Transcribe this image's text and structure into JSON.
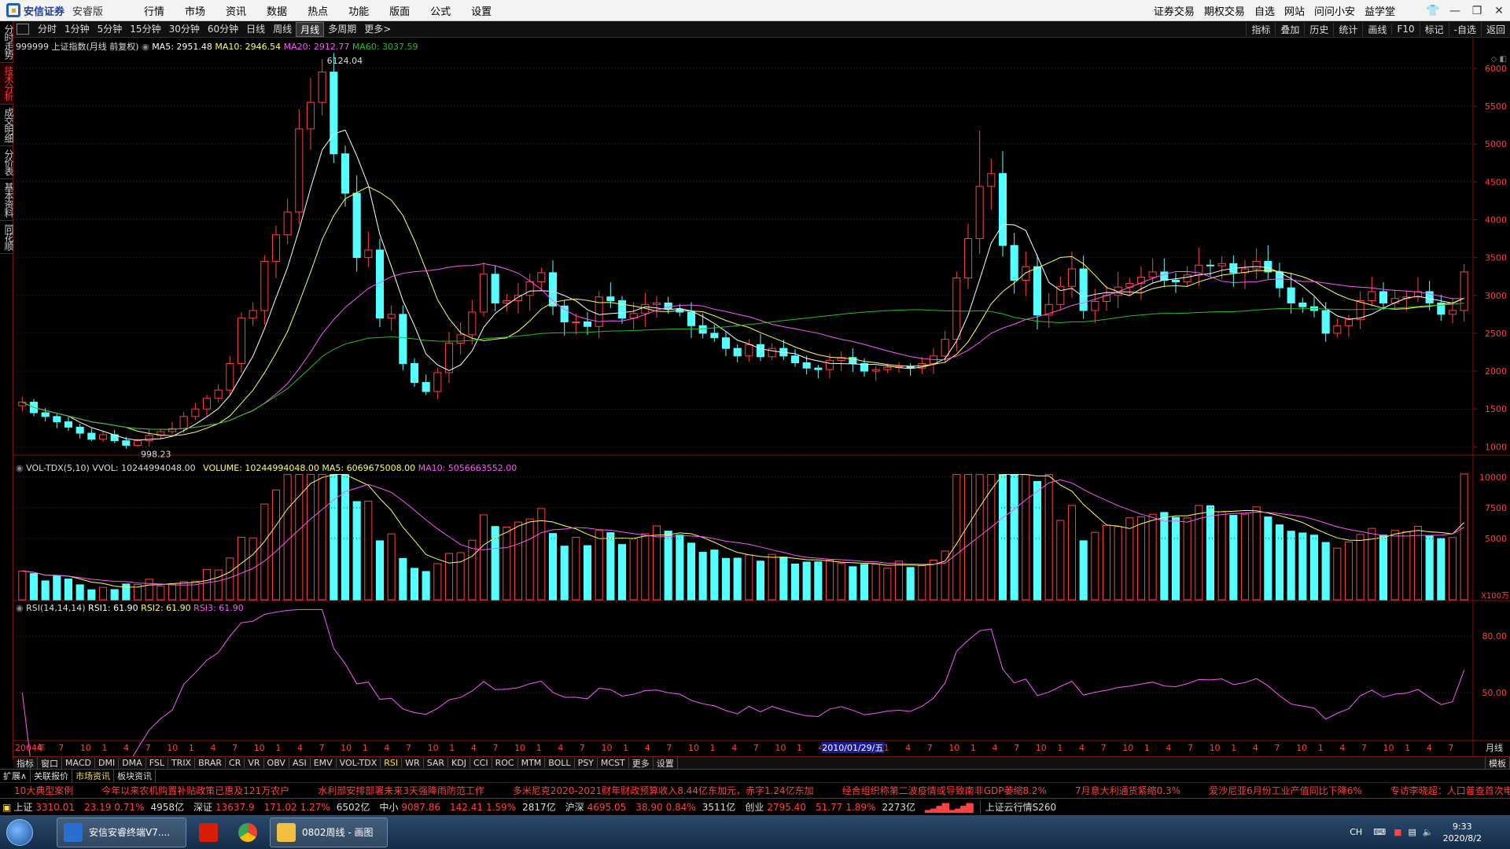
{
  "app": {
    "logo": "安信证券",
    "edition": "安睿版",
    "menu": [
      "行情",
      "市场",
      "资讯",
      "数据",
      "热点",
      "功能",
      "版面",
      "公式",
      "设置"
    ],
    "menu_right": [
      "证券交易",
      "期权交易",
      "自选",
      "网站",
      "问问小安",
      "益学堂"
    ],
    "window_controls": [
      "shirt-icon",
      "minimize-icon",
      "restore-icon",
      "close-icon"
    ]
  },
  "left_tabs": [
    "分时走势",
    "技术分析",
    "成交明细",
    "分价表",
    "基本资料",
    "同花顺"
  ],
  "left_tab_active": 1,
  "period_bar": {
    "items": [
      "分时",
      "1分钟",
      "5分钟",
      "15分钟",
      "30分钟",
      "60分钟",
      "日线",
      "周线",
      "月线",
      "多周期",
      "更多>"
    ],
    "active": "月线",
    "right_items": [
      "指标",
      "叠加",
      "历史",
      "统计",
      "画线",
      "F10",
      "标记",
      "-自选",
      "返回"
    ]
  },
  "main_chart": {
    "code_name": "999999 上证指数(月线 前复权)",
    "ma5": "MA5: 2951.48",
    "ma10": "MA10: 2946.54",
    "ma20": "MA20: 2912.77",
    "ma60": "MA60: 3037.59",
    "high_label": "6124.04",
    "low_label": "998.23",
    "y_ticks": [
      "6000",
      "5500",
      "5000",
      "4500",
      "4000",
      "3500",
      "3000",
      "2500",
      "2000",
      "1500",
      "1000"
    ],
    "corner_right": "月线"
  },
  "vol_chart": {
    "title": "VOL-TDX(5,10)",
    "vvol": "VVOL: 10244994048.00",
    "volume": "VOLUME: 10244994048.00",
    "ma5": "MA5: 6069675008.00",
    "ma10": "MA10: 5056663552.00",
    "y_ticks": [
      "10000",
      "7500",
      "5000"
    ],
    "unit": "X100万"
  },
  "rsi_chart": {
    "title": "RSI(14,14,14)",
    "rsi1": "RSI1: 61.90",
    "rsi2": "RSI2: 61.90",
    "rsi3": "RSI3: 61.90",
    "y_ticks": [
      "80.00",
      "50.00"
    ]
  },
  "x_axis": {
    "labels": [
      "2004年",
      "4",
      "7",
      "10",
      "1",
      "4",
      "7",
      "10",
      "1",
      "4",
      "7",
      "10",
      "1",
      "4",
      "7",
      "10",
      "1",
      "4",
      "7",
      "10",
      "1",
      "4",
      "7",
      "10",
      "1",
      "4",
      "7",
      "10",
      "1",
      "4",
      "7",
      "10",
      "1",
      "4",
      "7",
      "10",
      "1",
      "4",
      "7",
      "10",
      "1",
      "4",
      "7",
      "10",
      "1",
      "4",
      "7",
      "10",
      "1",
      "4",
      "7",
      "10",
      "1",
      "4",
      "7",
      "10",
      "1",
      "4",
      "7",
      "10",
      "1",
      "4",
      "7",
      "10",
      "1",
      "4",
      "7"
    ],
    "cursor_label": "2010/01/29/五"
  },
  "bottom_tabs": [
    "指标",
    "窗口",
    "MACD",
    "DMI",
    "DMA",
    "FSL",
    "TRIX",
    "BRAR",
    "CR",
    "VR",
    "OBV",
    "ASI",
    "EMV",
    "VOL-TDX",
    "RSI",
    "WR",
    "SAR",
    "KDJ",
    "CCI",
    "ROC",
    "MTM",
    "BOLL",
    "PSY",
    "MCST",
    "更多",
    "设置"
  ],
  "bottom_tabs_right": "模板",
  "news_tabs": [
    "扩展∧",
    "关联报价",
    "市场资讯",
    "板块资讯"
  ],
  "news_tab_active": "市场资讯",
  "ticker": [
    "10大典型案例",
    "今年以来农机购置补贴政策已惠及121万农户",
    "水利部安排部署未来3天强降雨防范工作",
    "多米尼克2020-2021财年财政预算收入8.44亿东加元，赤字1.24亿东加",
    "经合组织称第二波疫情或导致南非GDP萎缩8.2%",
    "7月意大利通货紧缩0.3%",
    "爱沙尼亚6月份工业产值同比下降6%",
    "专访李晓超：人口普查首次电子化登"
  ],
  "indexes": [
    {
      "name": "上证",
      "value": "3310.01",
      "chg": "23.19",
      "pct": "0.71%",
      "amt": "4958亿"
    },
    {
      "name": "深证",
      "value": "13637.9",
      "chg": "171.02",
      "pct": "1.27%",
      "amt": "6502亿"
    },
    {
      "name": "中小",
      "value": "9087.86",
      "chg": "142.41",
      "pct": "1.59%",
      "amt": "2817亿"
    },
    {
      "name": "沪深",
      "value": "4695.05",
      "chg": "38.90",
      "pct": "0.84%",
      "amt": "3511亿"
    },
    {
      "name": "创业",
      "value": "2795.40",
      "chg": "51.77",
      "pct": "1.89%",
      "amt": "2273亿"
    }
  ],
  "cloud_status": "上证云行情S260",
  "taskbar": {
    "tasks": [
      "安信安睿终端V7....",
      "0802周线 - 画图"
    ],
    "lang": "CH",
    "time": "9:33",
    "date": "2020/8/2"
  },
  "colors": {
    "up": "#ff4040",
    "down": "#54ffff",
    "ma5": "#ffffff",
    "ma10": "#ffff55",
    "ma20": "#ff55ff",
    "ma60": "#22c022",
    "grid": "#8a1010"
  },
  "chart_data": {
    "type": "candlestick",
    "title": "999999 上证指数(月线 前复权)",
    "ylim": [
      900,
      6300
    ],
    "approx_closes": [
      1590,
      1450,
      1400,
      1330,
      1260,
      1180,
      1100,
      1160,
      1080,
      1020,
      1080,
      1150,
      1200,
      1240,
      1400,
      1500,
      1640,
      1750,
      2100,
      2700,
      2800,
      3450,
      3800,
      4100,
      5200,
      5550,
      5950,
      4870,
      4350,
      3500,
      3600,
      2700,
      2750,
      2100,
      1850,
      1730,
      1980,
      2370,
      2480,
      2780,
      3280,
      2900,
      2930,
      3000,
      3180,
      3300,
      2860,
      2650,
      2650,
      2590,
      2980,
      2930,
      2700,
      2760,
      2880,
      2900,
      2820,
      2780,
      2600,
      2500,
      2440,
      2300,
      2200,
      2350,
      2190,
      2300,
      2200,
      2110,
      2040,
      2020,
      2140,
      2180,
      2100,
      2000,
      2020,
      2050,
      2060,
      2040,
      2100,
      2200,
      2420,
      3230,
      3750,
      4440,
      4610,
      3660,
      3200,
      3380,
      2740,
      2880,
      3120,
      3350,
      2800,
      2920,
      3000,
      3110,
      3160,
      3240,
      3310,
      3200,
      3180,
      3270,
      3400,
      3390,
      3420,
      3300,
      3350,
      3450,
      3310,
      3100,
      2900,
      2850,
      2800,
      2500,
      2600,
      2680,
      2930,
      3050,
      2900,
      2960,
      2980,
      3050,
      2900,
      2750,
      2800,
      3310
    ]
  }
}
